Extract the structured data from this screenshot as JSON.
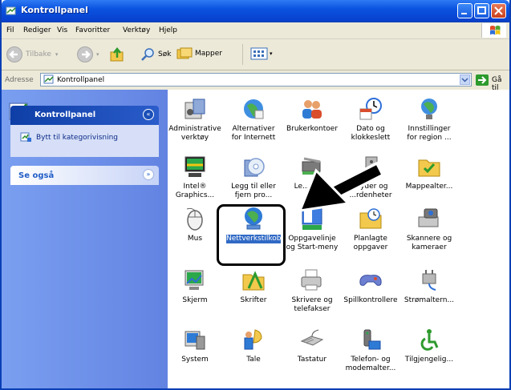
{
  "window": {
    "title": "Kontrollpanel"
  },
  "menubar": {
    "items": [
      "Fil",
      "Rediger",
      "Vis",
      "Favoritter",
      "Verktøy",
      "Hjelp"
    ]
  },
  "toolbar": {
    "back": "Tilbake",
    "search": "Søk",
    "folders": "Mapper"
  },
  "addressbar": {
    "label": "Adresse",
    "value": "Kontrollpanel",
    "go": "Gå til"
  },
  "leftpane": {
    "panel_title": "Kontrollpanel",
    "switch_link": "Bytt til kategorivisning",
    "see_also": "Se også"
  },
  "items": [
    {
      "label": "Administrative verktøy",
      "icon": "admin-tools-icon"
    },
    {
      "label": "Alternativer for Internett",
      "icon": "internet-options-icon"
    },
    {
      "label": "Brukerkontoer",
      "icon": "user-accounts-icon"
    },
    {
      "label": "Dato og klokkeslett",
      "icon": "date-time-icon"
    },
    {
      "label": "Innstillinger for region ...",
      "icon": "regional-settings-icon"
    },
    {
      "label": "Intel® Graphics...",
      "icon": "intel-graphics-icon"
    },
    {
      "label": "Legg til eller fjern pro...",
      "icon": "add-remove-programs-icon"
    },
    {
      "label": "Le... ma...",
      "icon": "add-hardware-icon"
    },
    {
      "label": "...yder og ...rdenheter",
      "icon": "sounds-audio-icon"
    },
    {
      "label": "Mappealter...",
      "icon": "folder-options-icon"
    },
    {
      "label": "Mus",
      "icon": "mouse-icon"
    },
    {
      "label": "Nettverkstilkoblinger",
      "icon": "network-connections-icon"
    },
    {
      "label": "Oppgavelinje og Start-meny",
      "icon": "taskbar-start-menu-icon"
    },
    {
      "label": "Planlagte oppgaver",
      "icon": "scheduled-tasks-icon"
    },
    {
      "label": "Skannere og kameraer",
      "icon": "scanners-cameras-icon"
    },
    {
      "label": "Skjerm",
      "icon": "display-icon"
    },
    {
      "label": "Skrifter",
      "icon": "fonts-icon"
    },
    {
      "label": "Skrivere og telefakser",
      "icon": "printers-faxes-icon"
    },
    {
      "label": "Spillkontrollere",
      "icon": "game-controllers-icon"
    },
    {
      "label": "Strømaltern...",
      "icon": "power-options-icon"
    },
    {
      "label": "System",
      "icon": "system-icon"
    },
    {
      "label": "Tale",
      "icon": "speech-icon"
    },
    {
      "label": "Tastatur",
      "icon": "keyboard-icon"
    },
    {
      "label": "Telefon- og modemalter...",
      "icon": "phone-modem-icon"
    },
    {
      "label": "Tilgjengelig...",
      "icon": "accessibility-icon"
    }
  ],
  "colors": {
    "titlebar": "#0a53e0",
    "selection": "#316ac5",
    "leftpane": "#6f8fe8"
  }
}
